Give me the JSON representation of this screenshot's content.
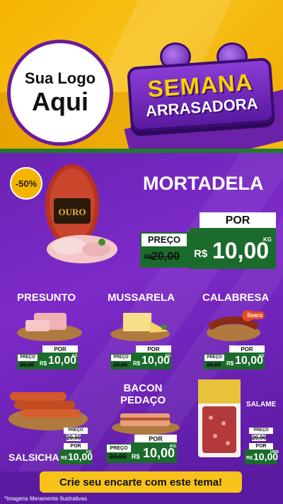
{
  "header": {
    "logo_line1": "Sua Logo",
    "logo_line2": "Aqui",
    "banner_line1": "SEMANA",
    "banner_line2": "ARRASADORA"
  },
  "featured": {
    "discount_badge": "-50%",
    "brand_on_pack": "OURO",
    "name": "MORTADELA",
    "por_label": "POR",
    "preco_label": "PREÇO",
    "old_price_prefix": "R$",
    "old_price": "20,00",
    "currency": "R$",
    "price": "10,00",
    "unit": "KG"
  },
  "products": [
    {
      "name": "PRESUNTO",
      "preco_label": "PREÇO",
      "por_label": "POR",
      "old_price": "20,00",
      "currency": "R$",
      "price": "10,00",
      "unit": "KG"
    },
    {
      "name": "MUSSARELA",
      "preco_label": "PREÇO",
      "por_label": "POR",
      "old_price": "20,00",
      "currency": "R$",
      "price": "10,00",
      "unit": "KG"
    },
    {
      "name": "CALABRESA",
      "preco_label": "PREÇO",
      "por_label": "POR",
      "old_price": "20,00",
      "currency": "R$",
      "price": "10,00",
      "unit": "KG",
      "brand": "Seara"
    },
    {
      "name": "SALSICHA",
      "preco_label": "PREÇO",
      "por_label": "POR",
      "old_price": "20,00",
      "currency": "R$",
      "price": "10,00",
      "unit": "KG"
    },
    {
      "name": "BACON\nPEDAÇO",
      "name_line1": "BACON",
      "name_line2": "PEDAÇO",
      "preco_label": "PREÇO",
      "por_label": "POR",
      "old_price": "20,00",
      "currency": "R$",
      "price": "10,00",
      "unit": "KG"
    },
    {
      "name": "SALAME",
      "preco_label": "PREÇO",
      "por_label": "POR",
      "old_price": "20,00",
      "currency": "R$",
      "price": "10,00",
      "unit": "UNID"
    }
  ],
  "footer": {
    "cta": "Crie seu encarte com este tema!",
    "disclaimer": "*Imagens Meramente Ilustrativas"
  },
  "colors": {
    "yellow": "#f5b400",
    "purple": "#6a23b3",
    "green": "#1b6b2c"
  }
}
